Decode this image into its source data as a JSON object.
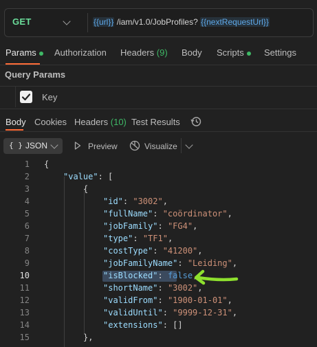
{
  "request": {
    "method": "GET",
    "url": {
      "var1": "{{url}}",
      "path": " /iam/v1.0/JobProfiles? ",
      "var2": "{{nextRequestUrl}}"
    }
  },
  "request_tabs": [
    {
      "label": "Params",
      "badge": "",
      "dot": true
    },
    {
      "label": "Authorization",
      "badge": "",
      "dot": false
    },
    {
      "label": "Headers",
      "badge": "(9)",
      "dot": false
    },
    {
      "label": "Body",
      "badge": "",
      "dot": false
    },
    {
      "label": "Scripts",
      "badge": "",
      "dot": true
    },
    {
      "label": "Settings",
      "badge": "",
      "dot": false
    }
  ],
  "query_params": {
    "title": "Query Params",
    "key_header": "Key"
  },
  "response_tabs": [
    {
      "label": "Body",
      "badge": ""
    },
    {
      "label": "Cookies",
      "badge": ""
    },
    {
      "label": "Headers",
      "badge": "(10)"
    },
    {
      "label": "Test Results",
      "badge": ""
    }
  ],
  "toolbar": {
    "format_icon": "{ }",
    "format": "JSON",
    "preview": "Preview",
    "visualize": "Visualize"
  },
  "code_lines": [
    {
      "n": "1",
      "parts": [
        [
          "p",
          "{"
        ]
      ]
    },
    {
      "n": "2",
      "parts": [
        [
          "k",
          "\"value\""
        ],
        [
          "p",
          ": ["
        ]
      ]
    },
    {
      "n": "3",
      "parts": [
        [
          "p",
          "{"
        ]
      ]
    },
    {
      "n": "4",
      "parts": [
        [
          "k",
          "\"id\""
        ],
        [
          "p",
          ": "
        ],
        [
          "s",
          "\"3002\""
        ],
        [
          "p",
          ","
        ]
      ]
    },
    {
      "n": "5",
      "parts": [
        [
          "k",
          "\"fullName\""
        ],
        [
          "p",
          ": "
        ],
        [
          "s",
          "\"coördinator\""
        ],
        [
          "p",
          ","
        ]
      ]
    },
    {
      "n": "6",
      "parts": [
        [
          "k",
          "\"jobFamily\""
        ],
        [
          "p",
          ": "
        ],
        [
          "s",
          "\"FG4\""
        ],
        [
          "p",
          ","
        ]
      ]
    },
    {
      "n": "7",
      "parts": [
        [
          "k",
          "\"type\""
        ],
        [
          "p",
          ": "
        ],
        [
          "s",
          "\"TF1\""
        ],
        [
          "p",
          ","
        ]
      ]
    },
    {
      "n": "8",
      "parts": [
        [
          "k",
          "\"costType\""
        ],
        [
          "p",
          ": "
        ],
        [
          "s",
          "\"41200\""
        ],
        [
          "p",
          ","
        ]
      ]
    },
    {
      "n": "9",
      "parts": [
        [
          "k",
          "\"jobFamilyName\""
        ],
        [
          "p",
          ": "
        ],
        [
          "s",
          "\"Leiding\""
        ],
        [
          "p",
          ","
        ]
      ]
    },
    {
      "n": "10",
      "parts": [
        [
          "k",
          "\"isBlocked\""
        ],
        [
          "p",
          ": "
        ],
        [
          "b",
          "false"
        ],
        [
          "p",
          ","
        ]
      ]
    },
    {
      "n": "11",
      "parts": [
        [
          "k",
          "\"shortName\""
        ],
        [
          "p",
          ": "
        ],
        [
          "s",
          "\"3002\""
        ],
        [
          "p",
          ","
        ]
      ]
    },
    {
      "n": "12",
      "parts": [
        [
          "k",
          "\"validFrom\""
        ],
        [
          "p",
          ": "
        ],
        [
          "s",
          "\"1900-01-01\""
        ],
        [
          "p",
          ","
        ]
      ]
    },
    {
      "n": "13",
      "parts": [
        [
          "k",
          "\"validUntil\""
        ],
        [
          "p",
          ": "
        ],
        [
          "s",
          "\"9999-12-31\""
        ],
        [
          "p",
          ","
        ]
      ]
    },
    {
      "n": "14",
      "parts": [
        [
          "k",
          "\"extensions\""
        ],
        [
          "p",
          ": []"
        ]
      ]
    },
    {
      "n": "15",
      "parts": [
        [
          "p",
          "},"
        ]
      ]
    }
  ],
  "colors": {
    "method": "#6bdd9a",
    "accent": "#ff6c37",
    "dot": "#3fb866",
    "variable": "#5ea8e8",
    "annotation_arrow": "#8ee02e"
  },
  "icons": [
    "chevron-down-icon",
    "checkbox-checked-icon",
    "history-icon",
    "braces-icon",
    "play-icon",
    "visualize-icon"
  ],
  "annotation": "green-arrow-pointing-left"
}
